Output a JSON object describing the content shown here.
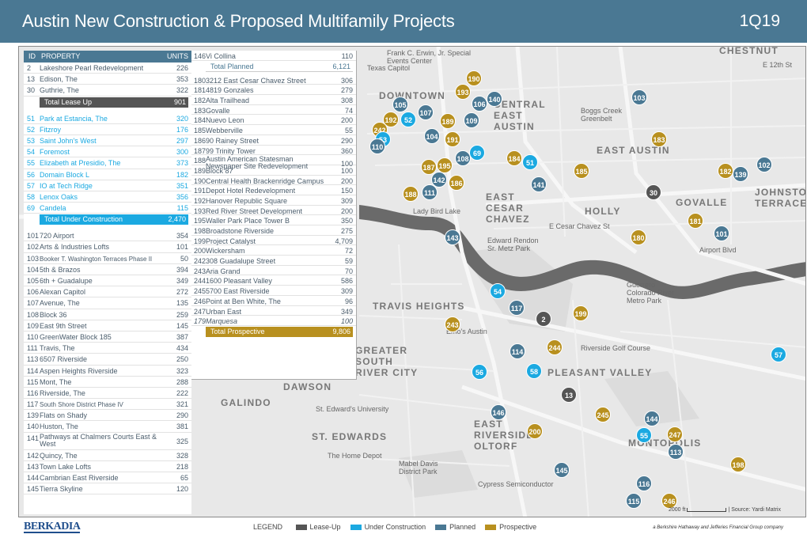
{
  "header": {
    "title": "Austin New Construction & Proposed Multifamily Projects",
    "quarter": "1Q19"
  },
  "colors": {
    "header": "#4a7893",
    "planned": "#4a7893",
    "prospective": "#b8901f",
    "under_construction": "#1ba9e1",
    "lease_up": "#555555"
  },
  "table_header": {
    "id": "ID",
    "property": "PROPERTY",
    "units": "UNITS"
  },
  "lease_up": [
    {
      "id": "2",
      "name": "Lakeshore Pearl Redevelopment",
      "units": "226"
    },
    {
      "id": "13",
      "name": "Edison, The",
      "units": "353"
    },
    {
      "id": "30",
      "name": "Guthrie, The",
      "units": "322"
    }
  ],
  "lease_up_total": {
    "label": "Total Lease Up",
    "units": "901"
  },
  "under_construction": [
    {
      "id": "51",
      "name": "Park at Estancia, The",
      "units": "320"
    },
    {
      "id": "52",
      "name": "Fitzroy",
      "units": "176"
    },
    {
      "id": "53",
      "name": "Saint John's West",
      "units": "297"
    },
    {
      "id": "54",
      "name": "Foremost",
      "units": "300"
    },
    {
      "id": "55",
      "name": "Elizabeth at Presidio, The",
      "units": "373"
    },
    {
      "id": "56",
      "name": "Domain Block L",
      "units": "182"
    },
    {
      "id": "57",
      "name": "IO at Tech Ridge",
      "units": "351"
    },
    {
      "id": "58",
      "name": "Lenox Oaks",
      "units": "356"
    },
    {
      "id": "69",
      "name": "Candela",
      "units": "115"
    }
  ],
  "under_construction_total": {
    "label": "Total Under Construction",
    "units": "2,470"
  },
  "planned_left": [
    {
      "id": "101",
      "name": "720 Airport",
      "units": "354"
    },
    {
      "id": "102",
      "name": "Arts & Industries Lofts",
      "units": "101"
    },
    {
      "id": "103",
      "name": "Booker T. Washington Terraces Phase II",
      "units": "50",
      "small": true
    },
    {
      "id": "104",
      "name": "5th & Brazos",
      "units": "394"
    },
    {
      "id": "105",
      "name": "6th + Guadalupe",
      "units": "349"
    },
    {
      "id": "106",
      "name": "Alexan Capitol",
      "units": "272"
    },
    {
      "id": "107",
      "name": "Avenue, The",
      "units": "135"
    },
    {
      "id": "108",
      "name": "Block 36",
      "units": "259"
    },
    {
      "id": "109",
      "name": "East 9th Street",
      "units": "145"
    },
    {
      "id": "110",
      "name": "GreenWater Block 185",
      "units": "387"
    },
    {
      "id": "111",
      "name": "Travis, The",
      "units": "434"
    },
    {
      "id": "113",
      "name": "6507 Riverside",
      "units": "250"
    },
    {
      "id": "114",
      "name": "Aspen Heights Riverside",
      "units": "323"
    },
    {
      "id": "115",
      "name": "Mont, The",
      "units": "288"
    },
    {
      "id": "116",
      "name": "Riverside, The",
      "units": "222"
    },
    {
      "id": "117",
      "name": "South Shore District Phase IV",
      "units": "321",
      "small": true
    },
    {
      "id": "139",
      "name": "Flats on Shady",
      "units": "290"
    },
    {
      "id": "140",
      "name": "Huston, The",
      "units": "381"
    },
    {
      "id": "141",
      "name": "Pathways at Chalmers Courts East & West",
      "units": "325",
      "two": true
    },
    {
      "id": "142",
      "name": "Quincy, The",
      "units": "328"
    },
    {
      "id": "143",
      "name": "Town Lake Lofts",
      "units": "218"
    },
    {
      "id": "144",
      "name": "Cambrian East Riverside",
      "units": "65"
    },
    {
      "id": "145",
      "name": "Tierra Skyline",
      "units": "120"
    }
  ],
  "planned_right": [
    {
      "id": "146",
      "name": "Vi Collina",
      "units": "110"
    }
  ],
  "planned_total": {
    "label": "Total Planned",
    "units": "6,121"
  },
  "prospective": [
    {
      "id": "180",
      "name": "3212 East Cesar Chavez Street",
      "units": "306"
    },
    {
      "id": "181",
      "name": "4819 Gonzales",
      "units": "279"
    },
    {
      "id": "182",
      "name": "Alta Trailhead",
      "units": "308"
    },
    {
      "id": "183",
      "name": "Govalle",
      "units": "74"
    },
    {
      "id": "184",
      "name": "Nuevo Leon",
      "units": "200"
    },
    {
      "id": "185",
      "name": "Webberville",
      "units": "55"
    },
    {
      "id": "186",
      "name": "90 Rainey Street",
      "units": "290"
    },
    {
      "id": "187",
      "name": "99 Trinity Tower",
      "units": "360"
    },
    {
      "id": "188",
      "name": "Austin American Statesman Newspaper Site Redevelopment",
      "units": "100",
      "two": true
    },
    {
      "id": "189",
      "name": "Block 87",
      "units": "100"
    },
    {
      "id": "190",
      "name": "Central Health Brackenridge Campus",
      "units": "200"
    },
    {
      "id": "191",
      "name": "Depot Hotel Redevelopment",
      "units": "150"
    },
    {
      "id": "192",
      "name": "Hanover Republic Square",
      "units": "309"
    },
    {
      "id": "193",
      "name": "Red River Street Development",
      "units": "200"
    },
    {
      "id": "195",
      "name": "Waller Park Place Tower B",
      "units": "350"
    },
    {
      "id": "198",
      "name": "Broadstone Riverside",
      "units": "275"
    },
    {
      "id": "199",
      "name": "Project Catalyst",
      "units": "4,709"
    },
    {
      "id": "200",
      "name": "Wickersham",
      "units": "72"
    },
    {
      "id": "242",
      "name": "308 Guadalupe Street",
      "units": "59"
    },
    {
      "id": "243",
      "name": "Aria Grand",
      "units": "70"
    },
    {
      "id": "244",
      "name": "1600 Pleasant Valley",
      "units": "586"
    },
    {
      "id": "245",
      "name": "5700 East Riverside",
      "units": "309"
    },
    {
      "id": "246",
      "name": "Point at Ben White, The",
      "units": "96"
    },
    {
      "id": "247",
      "name": "Urban East",
      "units": "349"
    },
    {
      "id": "179",
      "name": "Marquesa",
      "units": "100",
      "italic": true
    }
  ],
  "prospective_total": {
    "label": "Total Prospective",
    "units": "9,806"
  },
  "map_labels": [
    "CHESTNUT",
    "DOWNTOWN",
    "CENTRAL EAST AUSTIN",
    "EAST AUSTIN",
    "EAST CESAR CHAVEZ",
    "HOLLY",
    "GOVALLE",
    "JOHNSTON TERRACE",
    "TRAVIS HEIGHTS",
    "GREATER SOUTH RIVER CITY",
    "DAWSON",
    "GALINDO",
    "ST. EDWARDS",
    "EAST RIVERSIDE - OLTORF",
    "MONTOPOLIS",
    "PLEASANT VALLEY",
    "Boggs Creek Greenbelt",
    "Riverside Golf Course",
    "Emo's Austin",
    "Mabel Davis District Park",
    "The Home Depot",
    "Cypress Semiconductor",
    "St. Edward's University",
    "Texas Capitol",
    "Frank C. Erwin, Jr. Special Events Center",
    "Edward Rendon Sr. Metz Park",
    "Guerrero Colorado River Metro Park",
    "E 12th St",
    "E Cesar Chavez St",
    "Airport Blvd",
    "Lady Bird Lake"
  ],
  "markers": [
    {
      "id": "190",
      "cat": "Prospective"
    },
    {
      "id": "193",
      "cat": "Prospective"
    },
    {
      "id": "103",
      "cat": "Planned"
    },
    {
      "id": "105",
      "cat": "Planned"
    },
    {
      "id": "106",
      "cat": "Planned"
    },
    {
      "id": "140",
      "cat": "Planned"
    },
    {
      "id": "107",
      "cat": "Planned"
    },
    {
      "id": "192",
      "cat": "Prospective"
    },
    {
      "id": "52",
      "cat": "UC"
    },
    {
      "id": "189",
      "cat": "Prospective"
    },
    {
      "id": "109",
      "cat": "Planned"
    },
    {
      "id": "242",
      "cat": "Prospective"
    },
    {
      "id": "104",
      "cat": "Planned"
    },
    {
      "id": "53",
      "cat": "UC"
    },
    {
      "id": "191",
      "cat": "Prospective"
    },
    {
      "id": "183",
      "cat": "Prospective"
    },
    {
      "id": "110",
      "cat": "Planned"
    },
    {
      "id": "69",
      "cat": "UC"
    },
    {
      "id": "108",
      "cat": "Planned"
    },
    {
      "id": "184",
      "cat": "Prospective"
    },
    {
      "id": "51",
      "cat": "UC"
    },
    {
      "id": "187",
      "cat": "Prospective"
    },
    {
      "id": "195",
      "cat": "Prospective"
    },
    {
      "id": "185",
      "cat": "Prospective"
    },
    {
      "id": "182",
      "cat": "Prospective"
    },
    {
      "id": "139",
      "cat": "Planned"
    },
    {
      "id": "102",
      "cat": "Planned"
    },
    {
      "id": "142",
      "cat": "Planned"
    },
    {
      "id": "186",
      "cat": "Prospective"
    },
    {
      "id": "141",
      "cat": "Planned"
    },
    {
      "id": "188",
      "cat": "Prospective"
    },
    {
      "id": "111",
      "cat": "Planned"
    },
    {
      "id": "30",
      "cat": "LeaseUp"
    },
    {
      "id": "181",
      "cat": "Prospective"
    },
    {
      "id": "101",
      "cat": "Planned"
    },
    {
      "id": "143",
      "cat": "Planned"
    },
    {
      "id": "180",
      "cat": "Prospective"
    },
    {
      "id": "54",
      "cat": "UC"
    },
    {
      "id": "117",
      "cat": "Planned"
    },
    {
      "id": "199",
      "cat": "Prospective"
    },
    {
      "id": "2",
      "cat": "LeaseUp"
    },
    {
      "id": "243",
      "cat": "Prospective"
    },
    {
      "id": "244",
      "cat": "Prospective"
    },
    {
      "id": "114",
      "cat": "Planned"
    },
    {
      "id": "57",
      "cat": "UC"
    },
    {
      "id": "56",
      "cat": "UC"
    },
    {
      "id": "58",
      "cat": "UC"
    },
    {
      "id": "13",
      "cat": "LeaseUp"
    },
    {
      "id": "146",
      "cat": "Planned"
    },
    {
      "id": "245",
      "cat": "Prospective"
    },
    {
      "id": "144",
      "cat": "Planned"
    },
    {
      "id": "200",
      "cat": "Prospective"
    },
    {
      "id": "55",
      "cat": "UC"
    },
    {
      "id": "247",
      "cat": "Prospective"
    },
    {
      "id": "113",
      "cat": "Planned"
    },
    {
      "id": "198",
      "cat": "Prospective"
    },
    {
      "id": "145",
      "cat": "Planned"
    },
    {
      "id": "116",
      "cat": "Planned"
    },
    {
      "id": "115",
      "cat": "Planned"
    },
    {
      "id": "246",
      "cat": "Prospective"
    }
  ],
  "scale": {
    "label": "2000 ft",
    "source": "Source: Yardi Matrix"
  },
  "footer": {
    "logo": "BERKADIA",
    "legend_title": "LEGEND",
    "legend": [
      {
        "label": "Lease-Up",
        "color": "#555555"
      },
      {
        "label": "Under Construction",
        "color": "#1ba9e1"
      },
      {
        "label": "Planned",
        "color": "#4a7893"
      },
      {
        "label": "Prospective",
        "color": "#b8901f"
      }
    ],
    "company": "a Berkshire Hathaway and Jefferies Financial Group company"
  }
}
